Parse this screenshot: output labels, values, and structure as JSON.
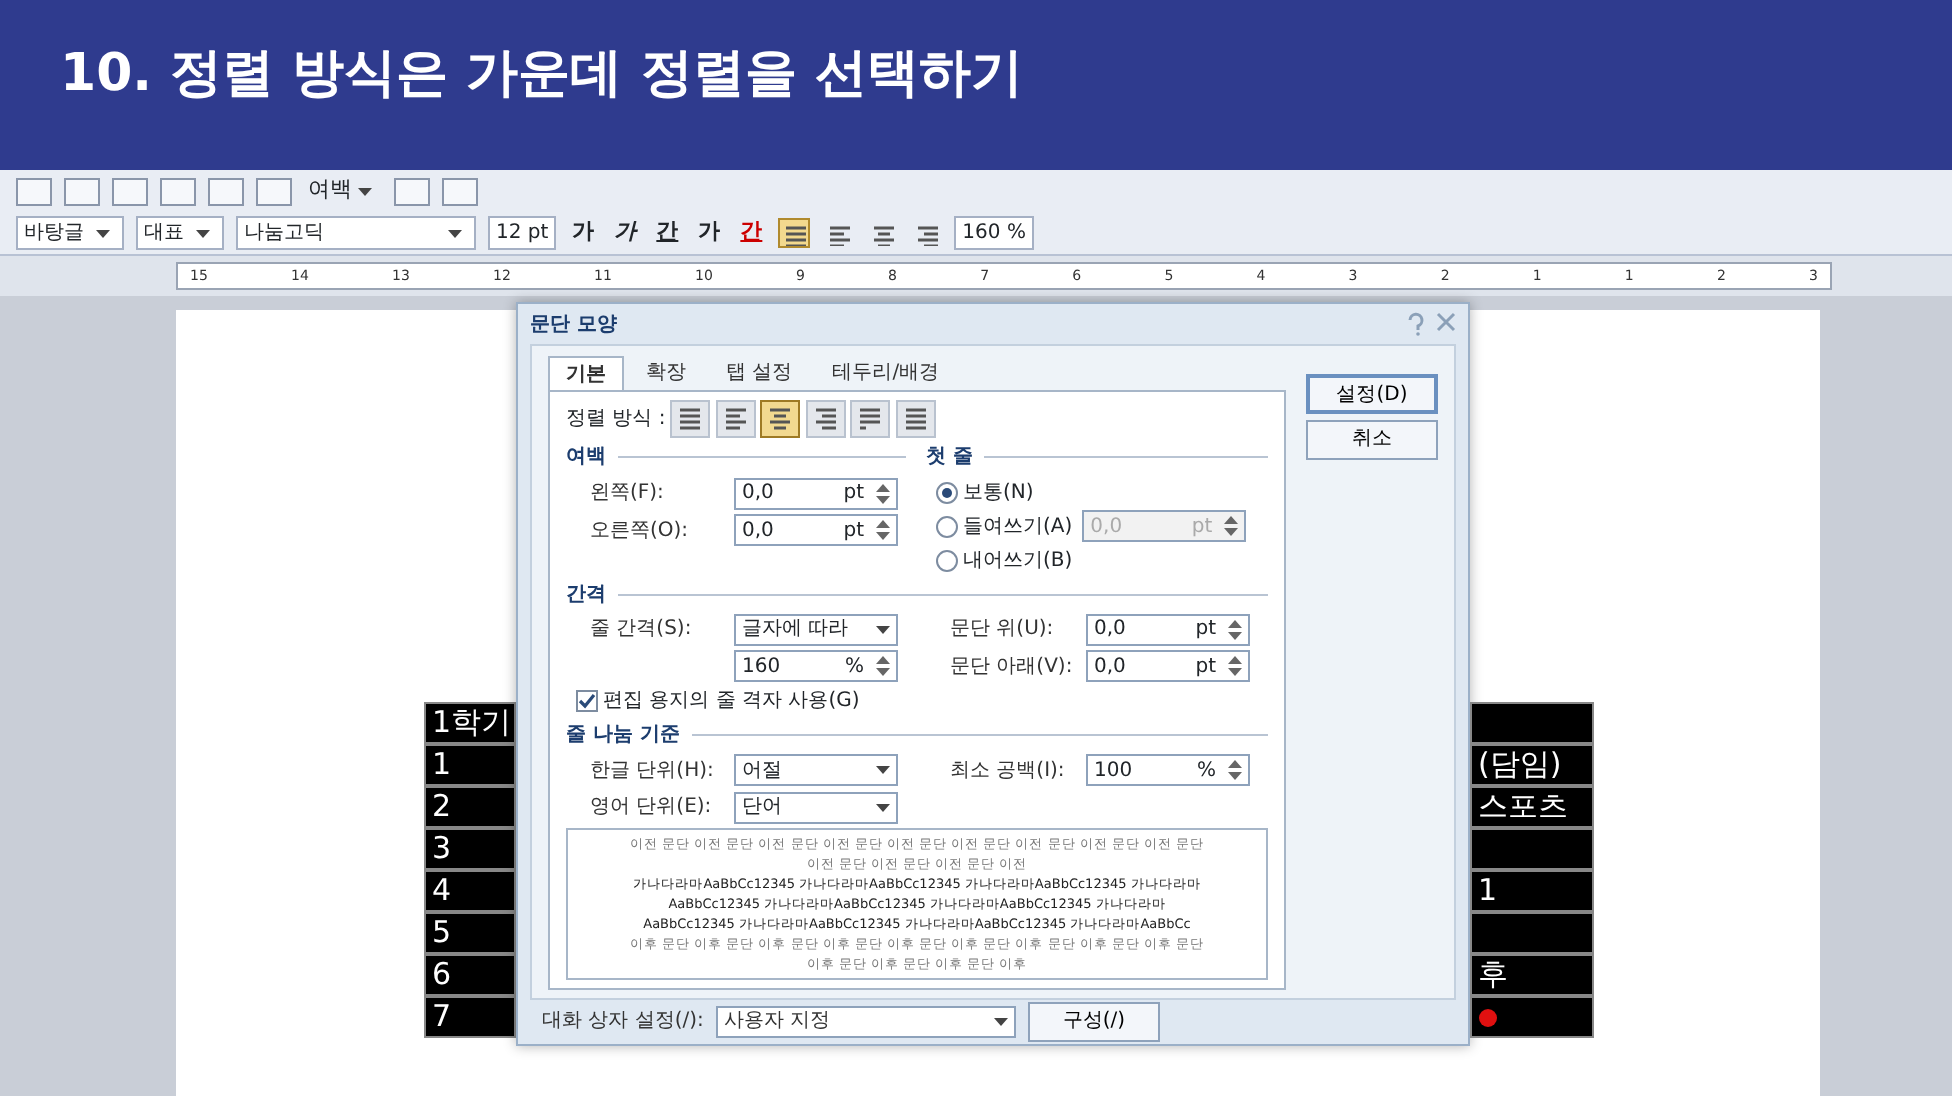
{
  "header": {
    "title": "10. 정렬 방식은 가운데 정렬을 선택하기"
  },
  "toolbar": {
    "margin_menu": "여백",
    "style": "바탕글",
    "language": "대표",
    "font": "나눔고딕",
    "size": "12",
    "size_unit": "pt",
    "format_buttons": [
      {
        "label": "가",
        "kind": "bold"
      },
      {
        "label": "가",
        "kind": "italic"
      },
      {
        "label": "간",
        "kind": "underline"
      },
      {
        "label": "가",
        "kind": "strike"
      },
      {
        "label": "간",
        "kind": "color"
      }
    ],
    "align_buttons": [
      {
        "selected": true
      },
      {
        "selected": false
      },
      {
        "selected": false
      },
      {
        "selected": false
      }
    ],
    "line_spacing": "160",
    "line_spacing_unit": "%"
  },
  "ruler": {
    "labels": [
      "15",
      "14",
      "13",
      "12",
      "11",
      "10",
      "9",
      "8",
      "7",
      "6",
      "5",
      "4",
      "3",
      "2",
      "1",
      "1",
      "2",
      "3"
    ]
  },
  "left_table": [
    "1학기",
    "1",
    "2",
    "3",
    "4",
    "5",
    "6",
    "7"
  ],
  "right_table": [
    {
      "kind": "blank"
    },
    {
      "kind": "text",
      "text": "(담임)"
    },
    {
      "kind": "text",
      "text": "스포츠"
    },
    {
      "kind": "blank"
    },
    {
      "kind": "text",
      "text": "1"
    },
    {
      "kind": "blank"
    },
    {
      "kind": "text",
      "text": "후"
    },
    {
      "kind": "marker"
    }
  ],
  "dialog": {
    "title": "문단 모양",
    "tabs": [
      {
        "label": "기본",
        "selected": true
      },
      {
        "label": "확장",
        "selected": false
      },
      {
        "label": "탭 설정",
        "selected": false
      },
      {
        "label": "테두리/배경",
        "selected": false
      }
    ],
    "buttons": [
      "설정(D)",
      "취소"
    ],
    "align_label": "정렬 방식 :",
    "align_options": [
      {
        "kind": "justify",
        "selected": false
      },
      {
        "kind": "left",
        "selected": false
      },
      {
        "kind": "center",
        "selected": true
      },
      {
        "kind": "right",
        "selected": false
      },
      {
        "kind": "distribute",
        "selected": false
      },
      {
        "kind": "divide",
        "selected": false
      }
    ],
    "margin": {
      "title": "여백",
      "fields": [
        {
          "label": "왼쪽(F):",
          "value": "0,0",
          "unit": "pt"
        },
        {
          "label": "오른쪽(O):",
          "value": "0,0",
          "unit": "pt"
        }
      ]
    },
    "first_line": {
      "title": "첫 줄",
      "options": [
        {
          "label": "보통(N)",
          "selected": true
        },
        {
          "label": "들여쓰기(A)",
          "selected": false
        },
        {
          "label": "내어쓰기(B)",
          "selected": false
        }
      ],
      "value": "0,0",
      "unit": "pt",
      "disabled": true
    },
    "spacing": {
      "title": "간격",
      "line_label": "줄 간격(S):",
      "line_type": "글자에 따라",
      "line_value": "160",
      "line_unit": "%",
      "fields": [
        {
          "label": "문단 위(U):",
          "value": "0,0",
          "unit": "pt"
        },
        {
          "label": "문단 아래(V):",
          "value": "0,0",
          "unit": "pt"
        }
      ],
      "grid_check": {
        "label": "편집 용지의 줄 격자 사용(G)",
        "checked": true
      }
    },
    "line_break": {
      "title": "줄 나눔 기준",
      "korean_label": "한글 단위(H):",
      "korean_value": "어절",
      "english_label": "영어 단위(E):",
      "english_value": "단어",
      "min_space_label": "최소 공백(I):",
      "min_space_value": "100",
      "min_space_unit": "%"
    },
    "preview": [
      {
        "kind": "previous",
        "text": "이전 문단 이전 문단 이전 문단 이전 문단 이전 문단 이전 문단 이전 문단 이전 문단 이전 문단 이전 문단 이전 문단 이전 문단 이전"
      },
      {
        "kind": "current",
        "text": "가나다라마AaBbCc12345 가나다라마AaBbCc12345 가나다라마AaBbCc12345 가나다라마AaBbCc12345 가나다라마AaBbCc12345 가나다라마AaBbCc12345 가나다라마AaBbCc12345 가나다라마AaBbCc12345 가나다라마AaBbCc12345 가나다라마AaBbCc"
      },
      {
        "kind": "next",
        "text": "이후 문단 이후 문단 이후 문단 이후 문단 이후 문단 이후 문단 이후 문단 이후 문단 이후 문단 이후 문단 이후 문단 이후 문단 이후"
      }
    ],
    "footer": {
      "label": "대화 상자 설정(/):",
      "value": "사용자 지정",
      "button": "구성(/)"
    }
  }
}
